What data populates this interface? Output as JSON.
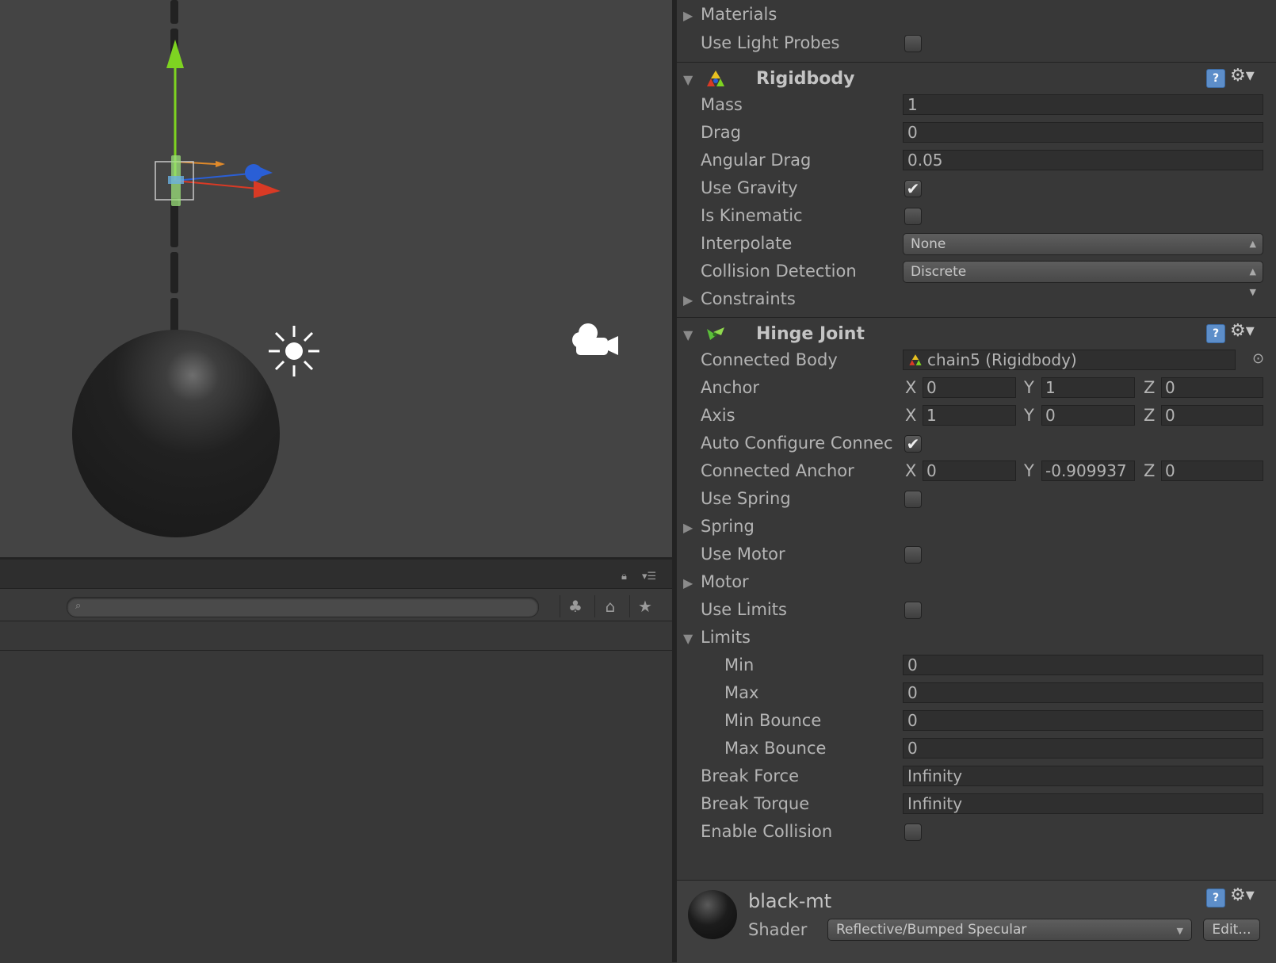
{
  "scene": {
    "label": "scene-view"
  },
  "bottom_panel": {
    "search": {
      "placeholder": "",
      "icon": "search-icon"
    },
    "lock_icon": "lock-icon",
    "menu_icon": "panel-menu-icon"
  },
  "inspector": {
    "renderer": {
      "materials_label": "Materials",
      "use_light_probes_label": "Use Light Probes",
      "use_light_probes": false
    },
    "rigidbody": {
      "title": "Rigidbody",
      "mass_label": "Mass",
      "mass": "1",
      "drag_label": "Drag",
      "drag": "0",
      "angular_drag_label": "Angular Drag",
      "angular_drag": "0.05",
      "use_gravity_label": "Use Gravity",
      "use_gravity": true,
      "is_kinematic_label": "Is Kinematic",
      "is_kinematic": false,
      "interpolate_label": "Interpolate",
      "interpolate": "None",
      "collision_detection_label": "Collision Detection",
      "collision_detection": "Discrete",
      "constraints_label": "Constraints"
    },
    "hinge_joint": {
      "title": "Hinge Joint",
      "connected_body_label": "Connected Body",
      "connected_body": "chain5 (Rigidbody)",
      "anchor_label": "Anchor",
      "anchor": {
        "x": "0",
        "y": "1",
        "z": "0"
      },
      "axis_label": "Axis",
      "axis": {
        "x": "1",
        "y": "0",
        "z": "0"
      },
      "auto_configure_label": "Auto Configure Connec",
      "auto_configure": true,
      "connected_anchor_label": "Connected Anchor",
      "connected_anchor": {
        "x": "0",
        "y": "-0.909937",
        "z": "0"
      },
      "use_spring_label": "Use Spring",
      "use_spring": false,
      "spring_label": "Spring",
      "use_motor_label": "Use Motor",
      "use_motor": false,
      "motor_label": "Motor",
      "use_limits_label": "Use Limits",
      "use_limits": false,
      "limits_label": "Limits",
      "min_label": "Min",
      "min": "0",
      "max_label": "Max",
      "max": "0",
      "min_bounce_label": "Min Bounce",
      "min_bounce": "0",
      "max_bounce_label": "Max Bounce",
      "max_bounce": "0",
      "break_force_label": "Break Force",
      "break_force": "Infinity",
      "break_torque_label": "Break Torque",
      "break_torque": "Infinity",
      "enable_collision_label": "Enable Collision",
      "enable_collision": false
    },
    "material": {
      "name": "black-mt",
      "shader_label": "Shader",
      "shader": "Reflective/Bumped Specular",
      "edit_label": "Edit..."
    },
    "axis_letters": {
      "x": "X",
      "y": "Y",
      "z": "Z"
    },
    "check_glyph": "✔"
  },
  "colors": {
    "gizmo_y": "#7ed321",
    "gizmo_z": "#2a5fd6",
    "gizmo_x": "#d93a25",
    "help_blue": "#5d8ec9"
  }
}
